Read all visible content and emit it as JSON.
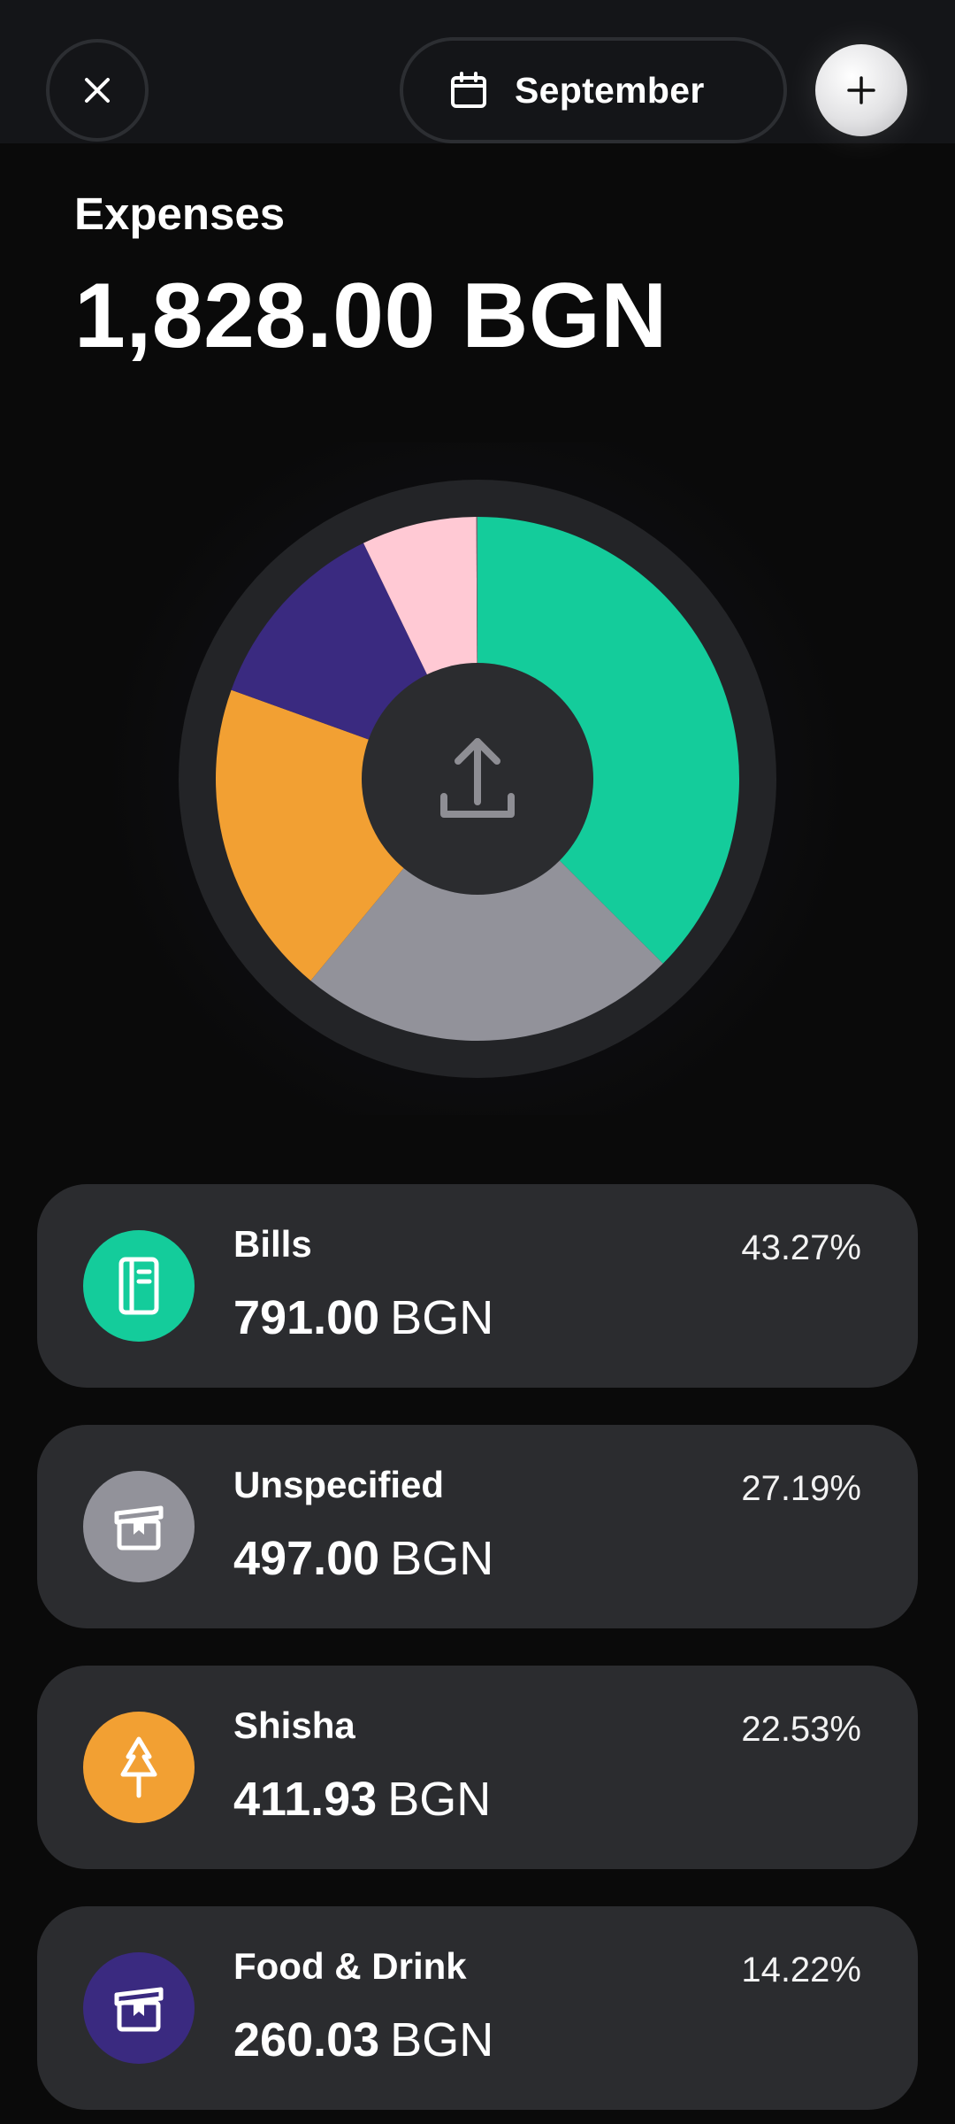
{
  "header": {
    "close_icon": "close-icon",
    "calendar_icon": "calendar-icon",
    "month_label": "September",
    "add_icon": "plus-icon"
  },
  "summary": {
    "title": "Expenses",
    "total": "1,828.00 BGN"
  },
  "chart_data": {
    "type": "pie",
    "style": "donut",
    "center_icon": "upload-icon",
    "slices": [
      {
        "label": "Bills",
        "value": 791.0,
        "percent": 43.27,
        "color": "#14cc9b"
      },
      {
        "label": "Unspecified",
        "value": 497.0,
        "percent": 27.19,
        "color": "#92929a"
      },
      {
        "label": "Shisha",
        "value": 411.93,
        "percent": 22.53,
        "color": "#f2a033"
      },
      {
        "label": "Food & Drink",
        "value": 260.03,
        "percent": 14.22,
        "color": "#3a2a80"
      },
      {
        "label": "",
        "value": 150.0,
        "percent": 8.2,
        "color": "#ffc9d4"
      },
      {
        "label": "",
        "value": 1.5,
        "percent": 0.08,
        "color": "#6a6a70"
      }
    ]
  },
  "categories": [
    {
      "name": "Bills",
      "amount": "791.00",
      "currency": "BGN",
      "percent": "43.27%",
      "color": "#14cc9b",
      "icon": "notebook-icon"
    },
    {
      "name": "Unspecified",
      "amount": "497.00",
      "currency": "BGN",
      "percent": "27.19%",
      "color": "#92929a",
      "icon": "box-icon"
    },
    {
      "name": "Shisha",
      "amount": "411.93",
      "currency": "BGN",
      "percent": "22.53%",
      "color": "#f2a033",
      "icon": "tree-icon"
    },
    {
      "name": "Food & Drink",
      "amount": "260.03",
      "currency": "BGN",
      "percent": "14.22%",
      "color": "#3a2a80",
      "icon": "box-icon"
    }
  ]
}
